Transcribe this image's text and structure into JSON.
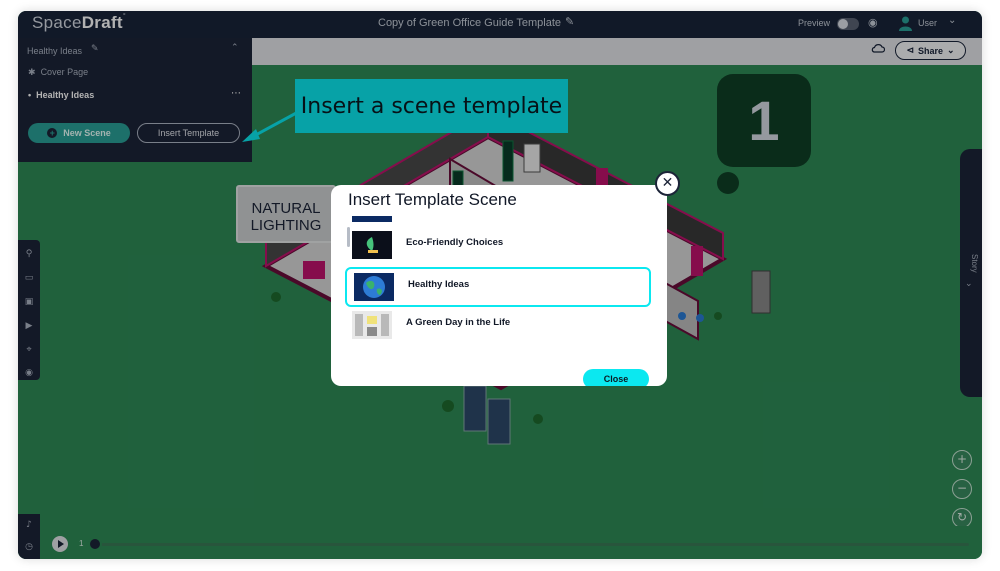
{
  "app": {
    "logo_part1": "Space",
    "logo_part2": "Draft",
    "document_title": "Copy of Green Office Guide Template",
    "preview_label": "Preview",
    "user_label": "User"
  },
  "toolbar": {
    "share_label": "Share"
  },
  "scene_panel": {
    "header": "Healthy Ideas",
    "items": [
      {
        "label": "Cover Page"
      },
      {
        "label": "Healthy Ideas"
      }
    ],
    "new_scene_label": "New Scene",
    "insert_template_label": "Insert Template"
  },
  "callout": {
    "text": "Insert a scene template"
  },
  "canvas": {
    "scene_number": "1",
    "sign_line1": "NATURAL",
    "sign_line2": "LIGHTING"
  },
  "story_panel": {
    "label": "Story"
  },
  "zoom": {
    "in_label": "+",
    "out_label": "−",
    "reset_label": "↻"
  },
  "timeline": {
    "current": "1"
  },
  "modal": {
    "title": "Insert Template Scene",
    "templates": [
      {
        "label": "Eco-Friendly Choices",
        "thumb_color": "#0b0f1a",
        "selected": false
      },
      {
        "label": "Healthy Ideas",
        "thumb_color": "#0b2a63",
        "selected": true
      },
      {
        "label": "A Green Day in the Life",
        "thumb_color": "#e9e9e9",
        "selected": false
      }
    ],
    "close_label": "Close"
  },
  "colors": {
    "dark_navy": "#19243a",
    "teal_accent": "#0be8f0",
    "canvas_green": "#2e8b57",
    "wall_magenta": "#c0136e"
  }
}
